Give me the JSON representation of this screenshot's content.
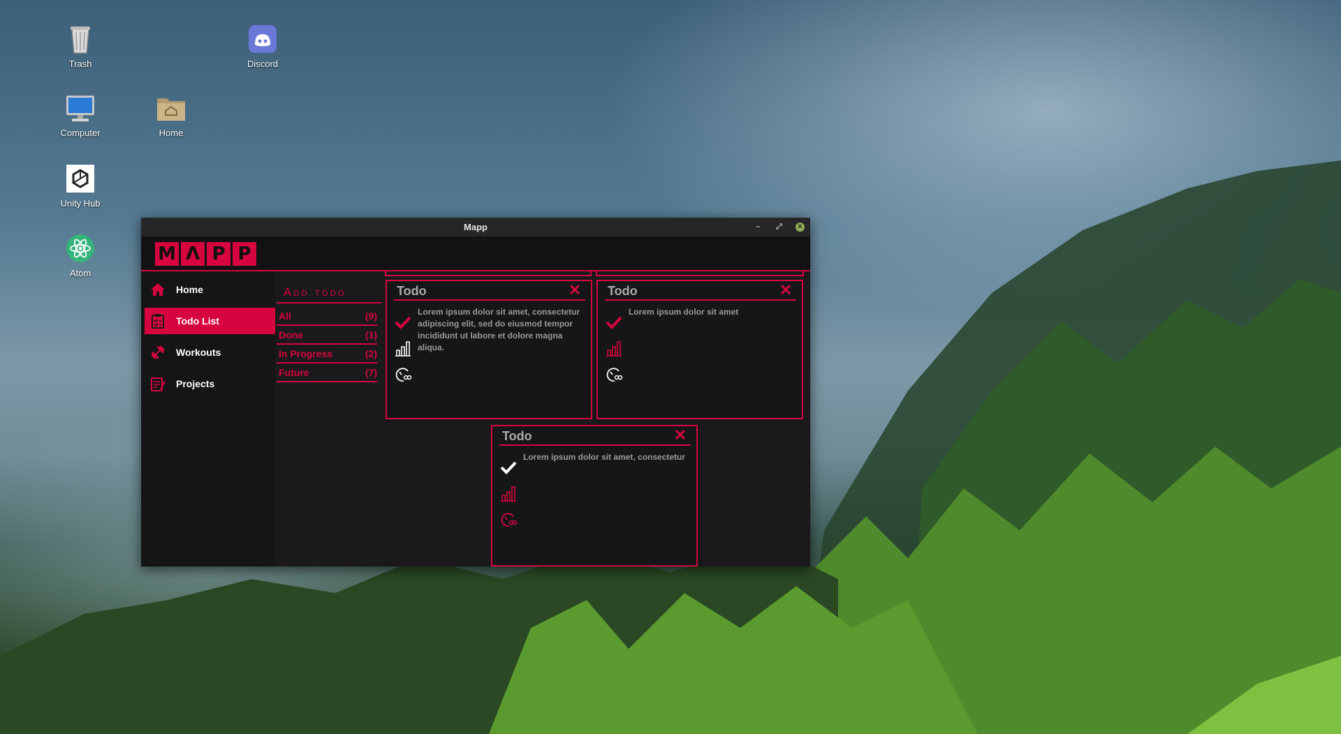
{
  "desktop": {
    "icons": [
      {
        "label": "Trash"
      },
      {
        "label": "Discord"
      },
      {
        "label": "Computer"
      },
      {
        "label": "Home"
      },
      {
        "label": "Unity Hub"
      },
      {
        "label": "Atom"
      }
    ]
  },
  "window": {
    "title": "Mapp",
    "controls": {
      "minimize": "–",
      "maximize": "⤢",
      "close": "×"
    }
  },
  "app": {
    "logo_letters": [
      "M",
      "Λ",
      "P",
      "P"
    ],
    "accent_color": "#d7053f",
    "nav": [
      {
        "label": "Home",
        "icon": "home-icon",
        "active": false
      },
      {
        "label": "Todo List",
        "icon": "clipboard-icon",
        "active": true
      },
      {
        "label": "Workouts",
        "icon": "dumbbell-icon",
        "active": false
      },
      {
        "label": "Projects",
        "icon": "notepad-icon",
        "active": false
      }
    ],
    "add_todo_label": "Add todo",
    "filters": [
      {
        "label": "All",
        "count": "(9)"
      },
      {
        "label": "Done",
        "count": "(1)"
      },
      {
        "label": "In Progress",
        "count": "(2)"
      },
      {
        "label": "Future",
        "count": "(7)"
      }
    ],
    "cards": [
      {
        "title": "Todo",
        "text": "Lorem ipsum dolor sit amet, consectetur adipiscing elit, sed do eiusmod tempor incididunt ut labore et dolore magna aliqua.",
        "check": "red",
        "progress": "white",
        "timer": "white"
      },
      {
        "title": "Todo",
        "text": "Lorem ipsum dolor sit amet",
        "check": "red",
        "progress": "red",
        "timer": "white"
      },
      {
        "title": "Todo",
        "text": "Lorem ipsum dolor sit amet, consectetur",
        "check": "white",
        "progress": "red",
        "timer": "red"
      }
    ]
  }
}
